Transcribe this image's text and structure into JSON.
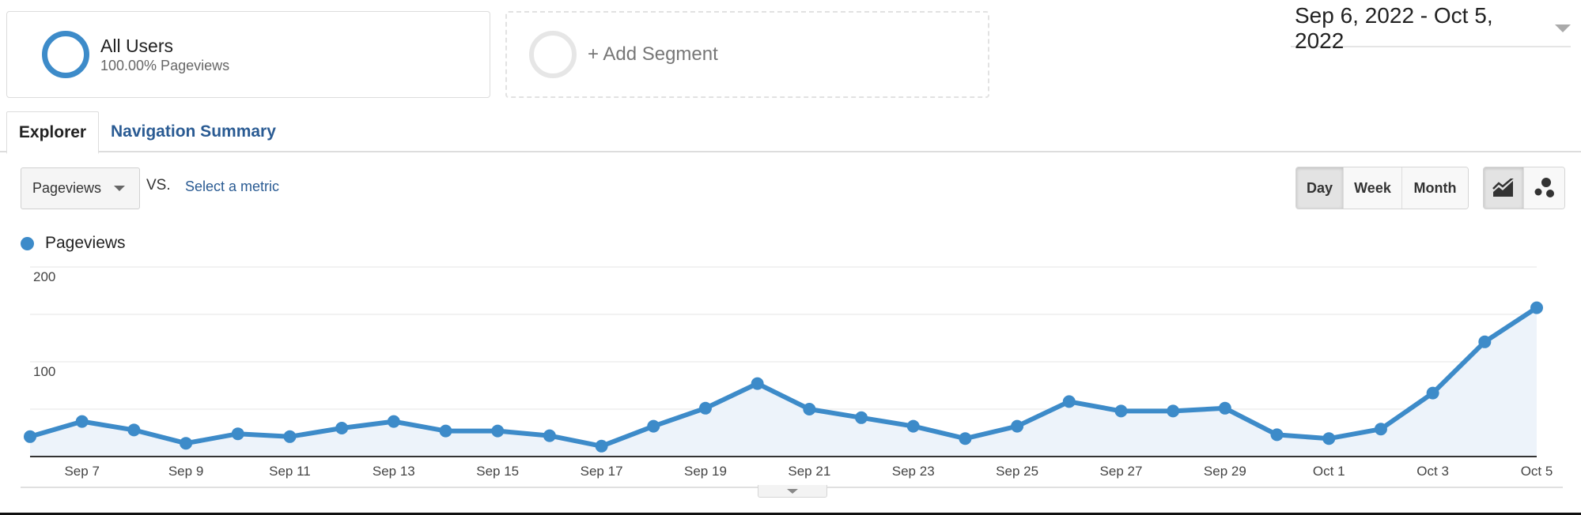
{
  "segments": {
    "active": {
      "title": "All Users",
      "subtitle": "100.00% Pageviews",
      "color": "#3d8bc9"
    },
    "add_label": "+ Add Segment"
  },
  "date_range": {
    "label": "Sep 6, 2022 - Oct 5, 2022",
    "icon": "caret-down-icon"
  },
  "tabs": [
    {
      "label": "Explorer",
      "active": true
    },
    {
      "label": "Navigation Summary",
      "active": false
    }
  ],
  "controls": {
    "metric_select": {
      "value": "Pageviews",
      "icon": "caret-down-icon"
    },
    "vs_label": "VS.",
    "select_metric_link": "Select a metric",
    "interval_buttons": [
      {
        "label": "Day",
        "active": true
      },
      {
        "label": "Week",
        "active": false
      },
      {
        "label": "Month",
        "active": false
      }
    ],
    "chart_type_buttons": [
      {
        "icon": "line-chart-icon",
        "active": true
      },
      {
        "icon": "motion-chart-icon",
        "active": false
      }
    ]
  },
  "legend": {
    "label": "Pageviews",
    "color": "#3d8bc9"
  },
  "chart_data": {
    "type": "area",
    "title": "",
    "xlabel": "",
    "ylabel": "",
    "ylim": [
      0,
      200
    ],
    "yticks": [
      100,
      200
    ],
    "y_gridlines": [
      50,
      100,
      150,
      200
    ],
    "grid": true,
    "legend": "top-left",
    "x": [
      "Sep 6",
      "Sep 7",
      "Sep 8",
      "Sep 9",
      "Sep 10",
      "Sep 11",
      "Sep 12",
      "Sep 13",
      "Sep 14",
      "Sep 15",
      "Sep 16",
      "Sep 17",
      "Sep 18",
      "Sep 19",
      "Sep 20",
      "Sep 21",
      "Sep 22",
      "Sep 23",
      "Sep 24",
      "Sep 25",
      "Sep 26",
      "Sep 27",
      "Sep 28",
      "Sep 29",
      "Sep 30",
      "Oct 1",
      "Oct 2",
      "Oct 3",
      "Oct 4",
      "Oct 5"
    ],
    "xtick_labels": [
      "Sep 7",
      "Sep 9",
      "Sep 11",
      "Sep 13",
      "Sep 15",
      "Sep 17",
      "Sep 19",
      "Sep 21",
      "Sep 23",
      "Sep 25",
      "Sep 27",
      "Sep 29",
      "Oct 1",
      "Oct 3",
      "Oct 5"
    ],
    "series": [
      {
        "name": "Pageviews",
        "color": "#3d8bc9",
        "fill": "#edf3fa",
        "values": [
          21,
          37,
          28,
          14,
          24,
          21,
          30,
          37,
          27,
          27,
          22,
          11,
          32,
          51,
          77,
          50,
          41,
          32,
          19,
          32,
          58,
          48,
          48,
          51,
          23,
          19,
          29,
          67,
          121,
          157
        ]
      }
    ]
  }
}
